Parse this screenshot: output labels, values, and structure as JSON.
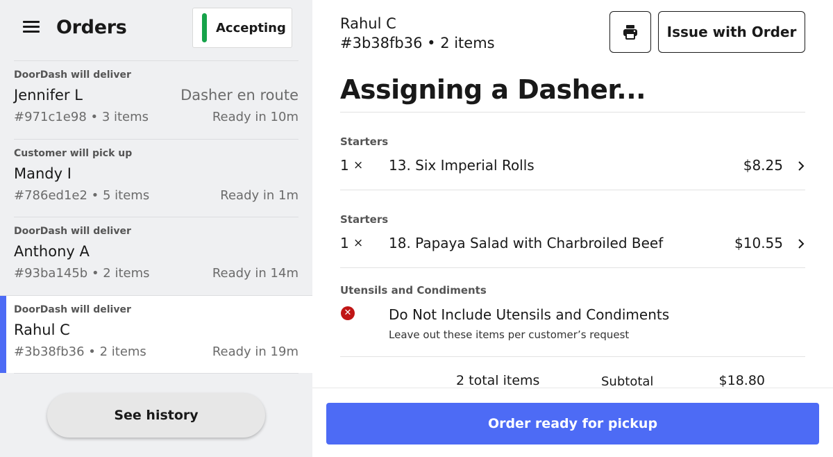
{
  "header": {
    "title": "Orders",
    "accepting_label": "Accepting",
    "accepting_color": "#16a34a"
  },
  "orders": [
    {
      "type": "DoorDash will deliver",
      "name": "Jennifer L",
      "status": "Dasher en route",
      "id_items": "#971c1e98 • 3 items",
      "ready": "Ready in 10m"
    },
    {
      "type": "Customer will pick up",
      "name": "Mandy I",
      "status": "",
      "id_items": "#786ed1e2 • 5 items",
      "ready": "Ready in 1m"
    },
    {
      "type": "DoorDash will deliver",
      "name": "Anthony A",
      "status": "",
      "id_items": "#93ba145b • 2 items",
      "ready": "Ready in 14m"
    },
    {
      "type": "DoorDash will deliver",
      "name": "Rahul C",
      "status": "",
      "id_items": "#3b38fb36 • 2 items",
      "ready": "Ready in 19m",
      "selected": true
    }
  ],
  "history_button": "See history",
  "detail": {
    "customer": "Rahul C",
    "meta": "#3b38fb36 • 2 items",
    "print_icon": "printer-icon",
    "issue_button": "Issue with Order",
    "status_title": "Assigning a Dasher...",
    "items": [
      {
        "section": "Starters",
        "qty": "1",
        "x": "×",
        "name": "13. Six Imperial Rolls",
        "price": "$8.25"
      },
      {
        "section": "Starters",
        "qty": "1",
        "x": "×",
        "name": "18. Papaya Salad with Charbroiled Beef",
        "price": "$10.55"
      }
    ],
    "utensils": {
      "section": "Utensils and Condiments",
      "icon": "error-x-icon",
      "name": "Do Not Include Utensils and Condiments",
      "note": "Leave out these items per customer’s request"
    },
    "total_items": "2 total items",
    "subtotal_label": "Subtotal",
    "subtotal_value": "$18.80",
    "ready_button": "Order ready for pickup"
  },
  "colors": {
    "accent": "#4d6bf5",
    "error": "#c01515",
    "panel_bg": "#eff0f2"
  }
}
